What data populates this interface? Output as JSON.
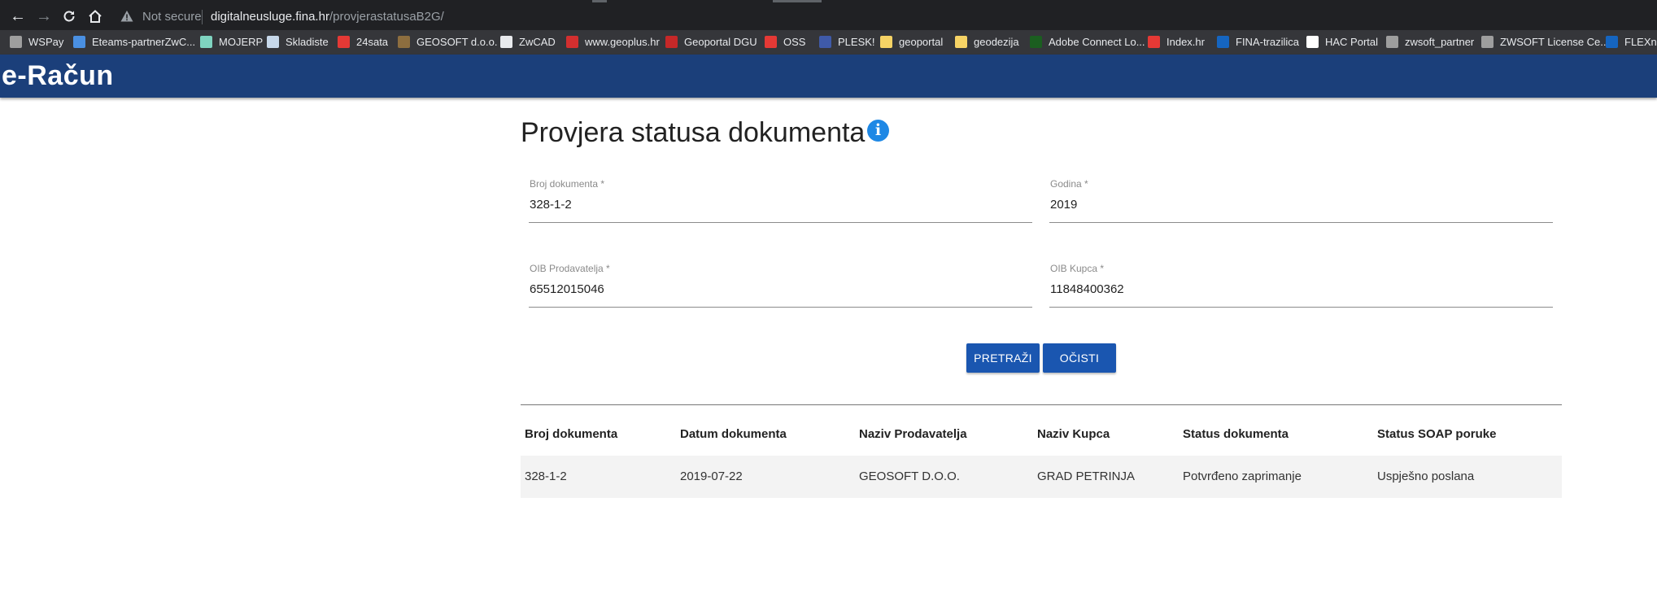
{
  "browser": {
    "not_secure": "Not secure",
    "url_host": "digitalneusluge.fina.hr",
    "url_path": "/provjerastatusaB2G/"
  },
  "bookmarks": [
    {
      "label": "WSPay",
      "color": "#9e9e9e"
    },
    {
      "label": "Eteams-partnerZwC...",
      "color": "#4a90e2"
    },
    {
      "label": "MOJERP",
      "color": "#7fd4c0"
    },
    {
      "label": "Skladiste",
      "color": "#c7d8ea"
    },
    {
      "label": "24sata",
      "color": "#e53935"
    },
    {
      "label": "GEOSOFT d.o.o.",
      "color": "#8d6e3f"
    },
    {
      "label": "ZwCAD",
      "color": "#e8eaed"
    },
    {
      "label": "www.geoplus.hr",
      "color": "#d32f2f"
    },
    {
      "label": "Geoportal DGU",
      "color": "#c62828"
    },
    {
      "label": "OSS",
      "color": "#e53935"
    },
    {
      "label": "PLESK!",
      "color": "#3f5aa8"
    },
    {
      "label": "geoportal",
      "color": "#f6d365"
    },
    {
      "label": "geodezija",
      "color": "#f6d365"
    },
    {
      "label": "Adobe Connect Lo...",
      "color": "#1b5e20"
    },
    {
      "label": "Index.hr",
      "color": "#e53935"
    },
    {
      "label": "FINA-trazilica",
      "color": "#1565c0"
    },
    {
      "label": "HAC Portal",
      "color": "#ffffff"
    },
    {
      "label": "zwsoft_partner",
      "color": "#9e9e9e"
    },
    {
      "label": "ZWSOFT License Ce...",
      "color": "#9e9e9e"
    },
    {
      "label": "FLEXne",
      "color": "#1565c0"
    }
  ],
  "app": {
    "logo": "e-Račun"
  },
  "page": {
    "title": "Provjera statusa dokumenta"
  },
  "form": {
    "broj_label": "Broj dokumenta *",
    "broj_value": "328-1-2",
    "godina_label": "Godina *",
    "godina_value": "2019",
    "oib_prod_label": "OIB Prodavatelja *",
    "oib_prod_value": "65512015046",
    "oib_kupca_label": "OIB Kupca *",
    "oib_kupca_value": "11848400362",
    "search_label": "PRETRAŽI",
    "clear_label": "OČISTI"
  },
  "results": {
    "columns": [
      "Broj dokumenta",
      "Datum dokumenta",
      "Naziv Prodavatelja",
      "Naziv Kupca",
      "Status dokumenta",
      "Status SOAP poruke"
    ],
    "rows": [
      [
        "328-1-2",
        "2019-07-22",
        "GEOSOFT D.O.O.",
        "GRAD PETRINJA",
        "Potvrđeno zaprimanje",
        "Uspješno poslana"
      ]
    ]
  },
  "colors": {
    "appbar": "#1b3f7a",
    "button": "#1a56b0",
    "info": "#1e88e5"
  }
}
